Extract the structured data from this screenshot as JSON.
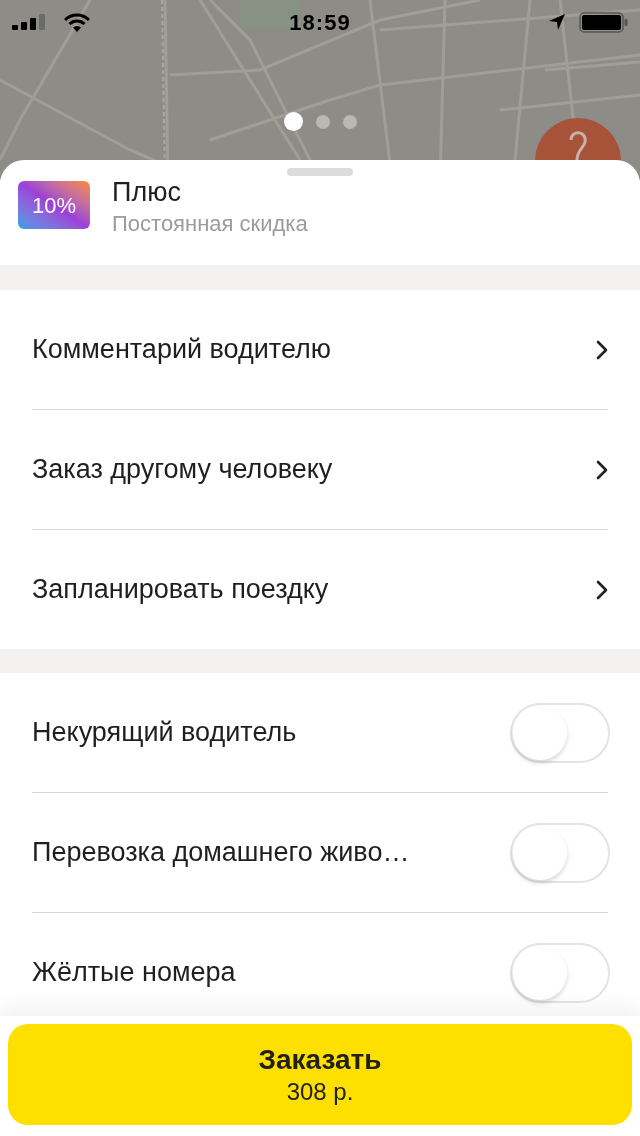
{
  "status_bar": {
    "time": "18:59"
  },
  "map": {
    "pages": [
      {
        "selected": true
      },
      {
        "selected": false
      },
      {
        "selected": false
      }
    ]
  },
  "plus": {
    "badge": "10%",
    "title": "Плюс",
    "subtitle": "Постоянная скидка"
  },
  "links": [
    {
      "label": "Комментарий водителю"
    },
    {
      "label": "Заказ другому человеку"
    },
    {
      "label": "Запланировать поездку"
    }
  ],
  "options": [
    {
      "label": "Некурящий водитель",
      "on": false
    },
    {
      "label": "Перевозка домашнего живо…",
      "on": false
    },
    {
      "label": "Жёлтые номера",
      "on": false
    }
  ],
  "order_button": {
    "label": "Заказать",
    "price": "308 р."
  }
}
